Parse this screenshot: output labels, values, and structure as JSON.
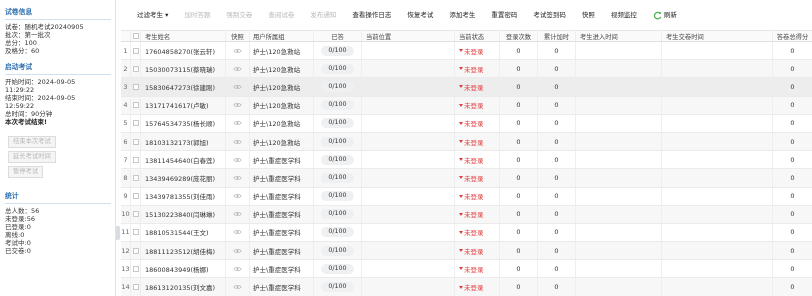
{
  "sidebar": {
    "section_info": "试卷信息",
    "info_lines": [
      "试卷：随机考试20240905",
      "批次：第一批次",
      "总分：100",
      "及格分：60"
    ],
    "section_start": "启动考试",
    "start_lines": [
      "开始时间：2024-09-05",
      "11:29:22",
      "结束时间：2024-09-05",
      "12:59:22",
      "总时间：90分钟"
    ],
    "finished_text": "本次考试结束!",
    "buttons": [
      "结束本次考试",
      "延长考试时间",
      "暂停考试"
    ],
    "section_stats": "统计",
    "stats_lines": [
      "总人数：56",
      "未登录:56",
      "已登录:0",
      "离线:0",
      "考试中:0",
      "已交卷:0"
    ]
  },
  "toolbar": {
    "filter": "过滤考生 ▾",
    "items": [
      {
        "label": "加时答题",
        "enabled": false
      },
      {
        "label": "强制交卷",
        "enabled": false
      },
      {
        "label": "查阅试卷",
        "enabled": false
      },
      {
        "label": "发布通知",
        "enabled": false
      },
      {
        "label": "查看操作日志",
        "enabled": true
      },
      {
        "label": "恢复考试",
        "enabled": true
      },
      {
        "label": "添加考生",
        "enabled": true
      },
      {
        "label": "重置密码",
        "enabled": true
      },
      {
        "label": "考试签到码",
        "enabled": true
      },
      {
        "label": "快照",
        "enabled": true
      },
      {
        "label": "视频监控",
        "enabled": true
      }
    ],
    "refresh": "刷新",
    "accent_color": "#2f6fb0",
    "refresh_icon_color": "#4caf50"
  },
  "table": {
    "headers": {
      "name": "考生姓名",
      "snapshot": "快照",
      "group": "用户所属组",
      "answered": "已答",
      "position": "当前位置",
      "status": "当前状态",
      "login_count": "登录次数",
      "extra_time": "累计加时",
      "enter_time": "考生进入时间",
      "submit_time": "考生交卷时间",
      "score": "答卷总得分"
    },
    "rows": [
      {
        "num": "1",
        "name": "17604858270(张云轩)",
        "group": "护士\\120急救站",
        "answered": "0/100",
        "status": "未登录",
        "login_count": "0",
        "extra_time": "0",
        "score": "0"
      },
      {
        "num": "2",
        "name": "15030073115(蔡晓瑞)",
        "group": "护士\\120急救站",
        "answered": "0/100",
        "status": "未登录",
        "login_count": "0",
        "extra_time": "0",
        "score": "0"
      },
      {
        "num": "3",
        "name": "15830647273(徐建刚)",
        "group": "护士\\120急救站",
        "answered": "0/100",
        "status": "未登录",
        "login_count": "0",
        "extra_time": "0",
        "score": "0"
      },
      {
        "num": "4",
        "name": "13171741617(卢敏)",
        "group": "护士\\120急救站",
        "answered": "0/100",
        "status": "未登录",
        "login_count": "0",
        "extra_time": "0",
        "score": "0"
      },
      {
        "num": "5",
        "name": "15764534735(杨长顺)",
        "group": "护士\\120急救站",
        "answered": "0/100",
        "status": "未登录",
        "login_count": "0",
        "extra_time": "0",
        "score": "0"
      },
      {
        "num": "6",
        "name": "18103132173(郭旭)",
        "group": "护士\\120急救站",
        "answered": "0/100",
        "status": "未登录",
        "login_count": "0",
        "extra_time": "0",
        "score": "0"
      },
      {
        "num": "7",
        "name": "13811454640(白春莲)",
        "group": "护士\\重症医学科",
        "answered": "0/100",
        "status": "未登录",
        "login_count": "0",
        "extra_time": "0",
        "score": "0"
      },
      {
        "num": "8",
        "name": "13439469289(庞花丽)",
        "group": "护士\\重症医学科",
        "answered": "0/100",
        "status": "未登录",
        "login_count": "0",
        "extra_time": "0",
        "score": "0"
      },
      {
        "num": "9",
        "name": "13439781355(刘佳雨)",
        "group": "护士\\重症医学科",
        "answered": "0/100",
        "status": "未登录",
        "login_count": "0",
        "extra_time": "0",
        "score": "0"
      },
      {
        "num": "10",
        "name": "15130223840(闫琳琳)",
        "group": "护士\\重症医学科",
        "answered": "0/100",
        "status": "未登录",
        "login_count": "0",
        "extra_time": "0",
        "score": "0"
      },
      {
        "num": "11",
        "name": "18810531544(王文)",
        "group": "护士\\重症医学科",
        "answered": "0/100",
        "status": "未登录",
        "login_count": "0",
        "extra_time": "0",
        "score": "0"
      },
      {
        "num": "12",
        "name": "18811123512(胡佳梅)",
        "group": "护士\\重症医学科",
        "answered": "0/100",
        "status": "未登录",
        "login_count": "0",
        "extra_time": "0",
        "score": "0"
      },
      {
        "num": "13",
        "name": "18600843949(杨娜)",
        "group": "护士\\重症医学科",
        "answered": "0/100",
        "status": "未登录",
        "login_count": "0",
        "extra_time": "0",
        "score": "0"
      },
      {
        "num": "14",
        "name": "18613120135(刘文嘉)",
        "group": "护士\\重症医学科",
        "answered": "0/100",
        "status": "未登录",
        "login_count": "0",
        "extra_time": "0",
        "score": "0"
      }
    ],
    "status_color": "#e03c3c",
    "selected_row": 3
  }
}
